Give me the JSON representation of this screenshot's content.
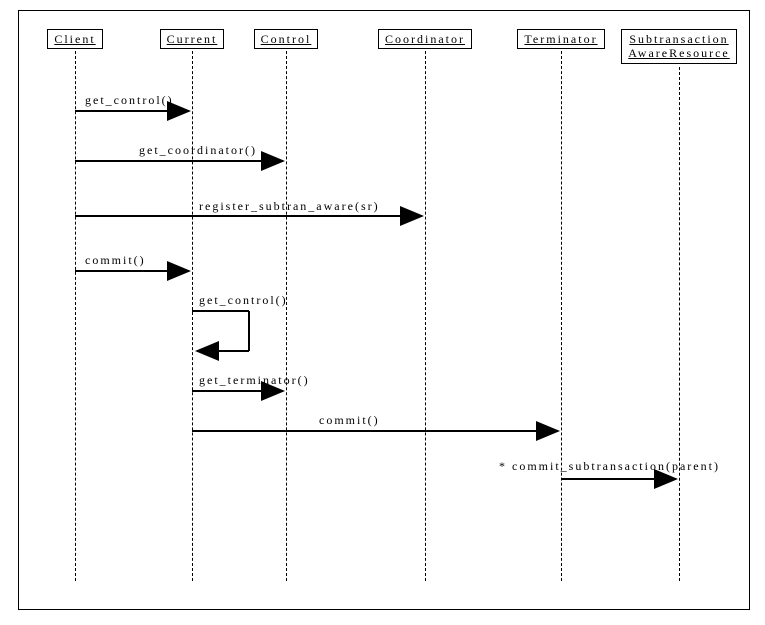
{
  "participants": {
    "client": "Client",
    "current": "Current",
    "control": "Control",
    "coordinator": "Coordinator",
    "terminator": "Terminator",
    "resource": "Subtransaction\nAwareResource"
  },
  "messages": {
    "m1": "get_control()",
    "m2": "get_coordinator()",
    "m3": "register_subtran_aware(sr)",
    "m4": "commit()",
    "m5": "get_control()",
    "m6": "get_terminator()",
    "m7": "commit()",
    "m8": "* commit_subtransaction(parent)"
  }
}
